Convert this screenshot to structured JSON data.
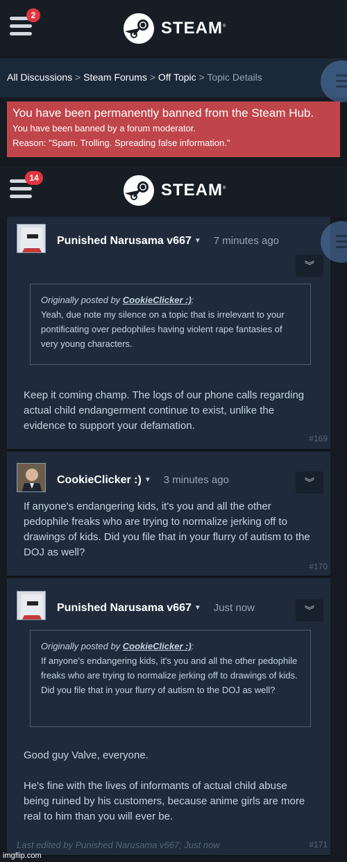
{
  "header1": {
    "badge": "2",
    "logo_text": "STEAM"
  },
  "breadcrumb": {
    "items": [
      "All Discussions",
      "Steam Forums",
      "Off Topic"
    ],
    "current": "Topic Details",
    "separator": ">"
  },
  "ban": {
    "title": "You have been permanently banned from the Steam Hub.",
    "line1": "You have been banned by a forum moderator.",
    "line2": "Reason: \"Spam. Trolling. Spreading false information.\""
  },
  "header2": {
    "badge": "14",
    "logo_text": "STEAM"
  },
  "posts": [
    {
      "author": "Punished Narusama v667",
      "time": "7 minutes ago",
      "quote_prefix": "Originally posted by",
      "quote_author": "CookieClicker :)",
      "quote_text": "Yeah, due note my silence on a topic that is irrelevant to your pontificating over pedophiles having violent rape fantasies of very young characters.",
      "text": "Keep it coming champ. The logs of our phone calls regarding actual child endangerment continue to exist, unlike the evidence to support your defamation.",
      "number": "#169"
    },
    {
      "author": "CookieClicker :)",
      "time": "3 minutes ago",
      "text": "If anyone's endangering kids, it's you and all the other pedophile freaks who are trying to normalize jerking off to drawings of kids. Did you file that in your flurry of autism to the DOJ as well?",
      "number": "#170"
    },
    {
      "author": "Punished Narusama v667",
      "time": "Just now",
      "quote_prefix": "Originally posted by",
      "quote_author": "CookieClicker :)",
      "quote_text": "If anyone's endangering kids, it's you and all the other pedophile freaks who are trying to normalize jerking off to drawings of kids. Did you file that in your flurry of autism to the DOJ as well?",
      "text1": "Good guy Valve, everyone.",
      "text2": "He's fine with the lives of informants of actual child abuse being ruined by his customers, because anime girls are more real to him than you will ever be.",
      "edited_prefix": "Last edited by",
      "edited_author": "Punished Narusama v667",
      "edited_suffix": "; Just now",
      "number": "#171"
    }
  ],
  "watermark": "imgflip.com",
  "colors": {
    "ban_bg": "#c0454a",
    "badge": "#e0353f",
    "post_bg": "#1f2b3b"
  }
}
